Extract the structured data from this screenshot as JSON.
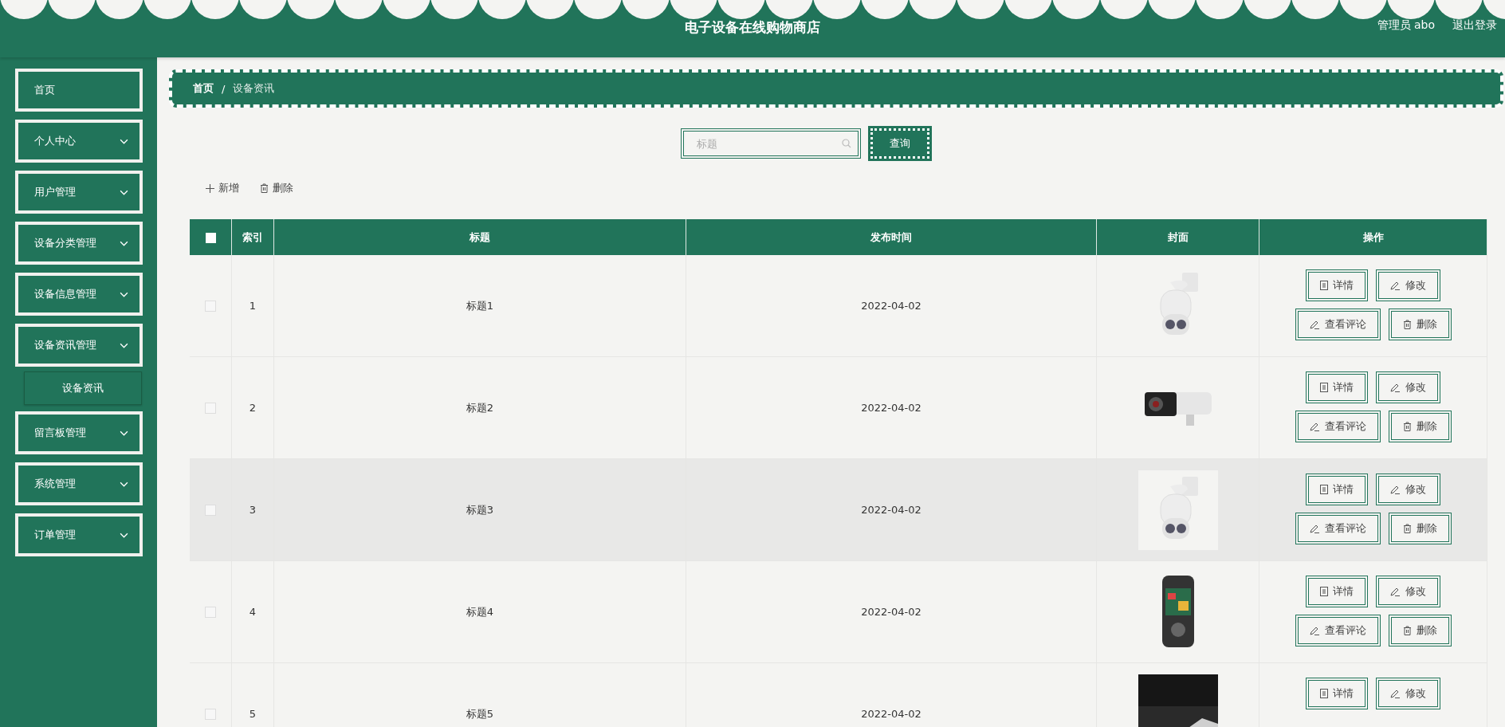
{
  "header": {
    "title": "电子设备在线购物商店",
    "user": "管理员 abo",
    "logout": "退出登录"
  },
  "sidebar": {
    "items": [
      {
        "label": "首页",
        "expandable": false
      },
      {
        "label": "个人中心",
        "expandable": true
      },
      {
        "label": "用户管理",
        "expandable": true
      },
      {
        "label": "设备分类管理",
        "expandable": true
      },
      {
        "label": "设备信息管理",
        "expandable": true
      },
      {
        "label": "设备资讯管理",
        "expandable": true,
        "expanded": true,
        "children": [
          {
            "label": "设备资讯",
            "selected": true
          }
        ]
      },
      {
        "label": "留言板管理",
        "expandable": true
      },
      {
        "label": "系统管理",
        "expandable": true
      },
      {
        "label": "订单管理",
        "expandable": true
      }
    ]
  },
  "breadcrumb": {
    "separator": "/",
    "items": [
      {
        "label": "首页",
        "current": false
      },
      {
        "label": "设备资讯",
        "current": true
      }
    ]
  },
  "search": {
    "placeholder": "标题",
    "button": "查询"
  },
  "toolbar": [
    {
      "label": "新增",
      "kind": "add"
    },
    {
      "label": "删除",
      "kind": "delete"
    }
  ],
  "table": {
    "checked": false,
    "columns": [
      "索引",
      "标题",
      "发布时间",
      "封面",
      "操作"
    ],
    "rows": [
      {
        "checked": false,
        "highlighted": false,
        "index": "1",
        "title": "标题1",
        "date": "2022-04-02",
        "cover": {
          "kind": "picture"
        },
        "actions": [
          {
            "label": "详情",
            "kind": "detail"
          },
          {
            "label": "修改",
            "kind": "edit"
          },
          {
            "label": "查看评论",
            "kind": "comments"
          },
          {
            "label": "删除",
            "kind": "delete"
          }
        ]
      },
      {
        "checked": false,
        "highlighted": false,
        "index": "2",
        "title": "标题2",
        "date": "2022-04-02",
        "cover": {
          "kind": "picture"
        },
        "actions": [
          {
            "label": "详情",
            "kind": "detail"
          },
          {
            "label": "修改",
            "kind": "edit"
          },
          {
            "label": "查看评论",
            "kind": "comments"
          },
          {
            "label": "删除",
            "kind": "delete"
          }
        ]
      },
      {
        "checked": false,
        "highlighted": true,
        "index": "3",
        "title": "标题3",
        "date": "2022-04-02",
        "cover": {
          "kind": "picture"
        },
        "actions": [
          {
            "label": "详情",
            "kind": "detail"
          },
          {
            "label": "修改",
            "kind": "edit"
          },
          {
            "label": "查看评论",
            "kind": "comments"
          },
          {
            "label": "删除",
            "kind": "delete"
          }
        ]
      },
      {
        "checked": false,
        "highlighted": false,
        "index": "4",
        "title": "标题4",
        "date": "2022-04-02",
        "cover": {
          "kind": "picture"
        },
        "actions": [
          {
            "label": "详情",
            "kind": "detail"
          },
          {
            "label": "修改",
            "kind": "edit"
          },
          {
            "label": "查看评论",
            "kind": "comments"
          },
          {
            "label": "删除",
            "kind": "delete"
          }
        ]
      },
      {
        "checked": false,
        "highlighted": false,
        "index": "5",
        "title": "标题5",
        "date": "2022-04-02",
        "cover": {
          "kind": "picture"
        },
        "actions": [
          {
            "label": "详情",
            "kind": "detail"
          },
          {
            "label": "修改",
            "kind": "edit"
          }
        ]
      }
    ]
  }
}
